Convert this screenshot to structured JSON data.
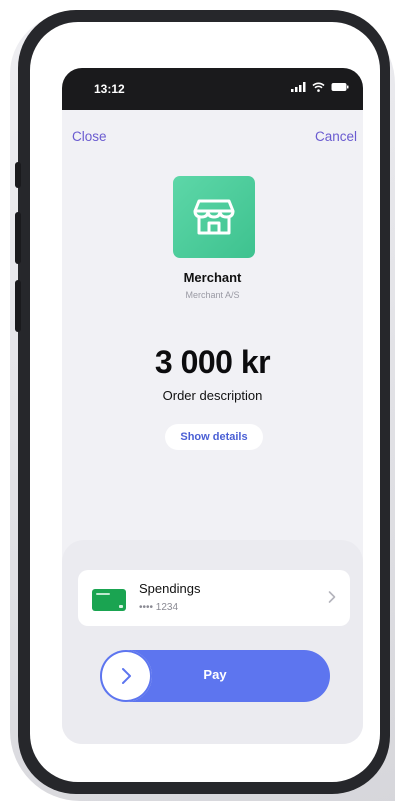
{
  "status_bar": {
    "time": "13:12",
    "icons": [
      "cellular-signal-icon",
      "wifi-icon",
      "battery-icon"
    ]
  },
  "header": {
    "close_label": "Close",
    "cancel_label": "Cancel"
  },
  "merchant": {
    "logo_icon": "storefront-icon",
    "name": "Merchant",
    "legal_name": "Merchant A/S"
  },
  "payment": {
    "amount": "3 000 kr",
    "description": "Order description",
    "details_label": "Show details"
  },
  "card": {
    "title": "Spendings",
    "masked_number": "•••• 1234"
  },
  "pay": {
    "label": "Pay"
  },
  "colors": {
    "accent": "#5d75ef",
    "link": "#6a5bd0",
    "merchant_logo": "#4ccc9b",
    "card": "#1aa451"
  }
}
